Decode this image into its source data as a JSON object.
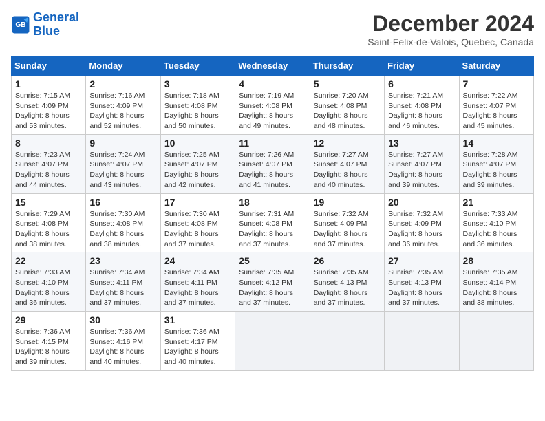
{
  "header": {
    "logo_line1": "General",
    "logo_line2": "Blue",
    "month_year": "December 2024",
    "location": "Saint-Felix-de-Valois, Quebec, Canada"
  },
  "weekdays": [
    "Sunday",
    "Monday",
    "Tuesday",
    "Wednesday",
    "Thursday",
    "Friday",
    "Saturday"
  ],
  "weeks": [
    [
      {
        "day": "1",
        "sunrise": "7:15 AM",
        "sunset": "4:09 PM",
        "daylight": "8 hours and 53 minutes."
      },
      {
        "day": "2",
        "sunrise": "7:16 AM",
        "sunset": "4:09 PM",
        "daylight": "8 hours and 52 minutes."
      },
      {
        "day": "3",
        "sunrise": "7:18 AM",
        "sunset": "4:08 PM",
        "daylight": "8 hours and 50 minutes."
      },
      {
        "day": "4",
        "sunrise": "7:19 AM",
        "sunset": "4:08 PM",
        "daylight": "8 hours and 49 minutes."
      },
      {
        "day": "5",
        "sunrise": "7:20 AM",
        "sunset": "4:08 PM",
        "daylight": "8 hours and 48 minutes."
      },
      {
        "day": "6",
        "sunrise": "7:21 AM",
        "sunset": "4:08 PM",
        "daylight": "8 hours and 46 minutes."
      },
      {
        "day": "7",
        "sunrise": "7:22 AM",
        "sunset": "4:07 PM",
        "daylight": "8 hours and 45 minutes."
      }
    ],
    [
      {
        "day": "8",
        "sunrise": "7:23 AM",
        "sunset": "4:07 PM",
        "daylight": "8 hours and 44 minutes."
      },
      {
        "day": "9",
        "sunrise": "7:24 AM",
        "sunset": "4:07 PM",
        "daylight": "8 hours and 43 minutes."
      },
      {
        "day": "10",
        "sunrise": "7:25 AM",
        "sunset": "4:07 PM",
        "daylight": "8 hours and 42 minutes."
      },
      {
        "day": "11",
        "sunrise": "7:26 AM",
        "sunset": "4:07 PM",
        "daylight": "8 hours and 41 minutes."
      },
      {
        "day": "12",
        "sunrise": "7:27 AM",
        "sunset": "4:07 PM",
        "daylight": "8 hours and 40 minutes."
      },
      {
        "day": "13",
        "sunrise": "7:27 AM",
        "sunset": "4:07 PM",
        "daylight": "8 hours and 39 minutes."
      },
      {
        "day": "14",
        "sunrise": "7:28 AM",
        "sunset": "4:07 PM",
        "daylight": "8 hours and 39 minutes."
      }
    ],
    [
      {
        "day": "15",
        "sunrise": "7:29 AM",
        "sunset": "4:08 PM",
        "daylight": "8 hours and 38 minutes."
      },
      {
        "day": "16",
        "sunrise": "7:30 AM",
        "sunset": "4:08 PM",
        "daylight": "8 hours and 38 minutes."
      },
      {
        "day": "17",
        "sunrise": "7:30 AM",
        "sunset": "4:08 PM",
        "daylight": "8 hours and 37 minutes."
      },
      {
        "day": "18",
        "sunrise": "7:31 AM",
        "sunset": "4:08 PM",
        "daylight": "8 hours and 37 minutes."
      },
      {
        "day": "19",
        "sunrise": "7:32 AM",
        "sunset": "4:09 PM",
        "daylight": "8 hours and 37 minutes."
      },
      {
        "day": "20",
        "sunrise": "7:32 AM",
        "sunset": "4:09 PM",
        "daylight": "8 hours and 36 minutes."
      },
      {
        "day": "21",
        "sunrise": "7:33 AM",
        "sunset": "4:10 PM",
        "daylight": "8 hours and 36 minutes."
      }
    ],
    [
      {
        "day": "22",
        "sunrise": "7:33 AM",
        "sunset": "4:10 PM",
        "daylight": "8 hours and 36 minutes."
      },
      {
        "day": "23",
        "sunrise": "7:34 AM",
        "sunset": "4:11 PM",
        "daylight": "8 hours and 37 minutes."
      },
      {
        "day": "24",
        "sunrise": "7:34 AM",
        "sunset": "4:11 PM",
        "daylight": "8 hours and 37 minutes."
      },
      {
        "day": "25",
        "sunrise": "7:35 AM",
        "sunset": "4:12 PM",
        "daylight": "8 hours and 37 minutes."
      },
      {
        "day": "26",
        "sunrise": "7:35 AM",
        "sunset": "4:13 PM",
        "daylight": "8 hours and 37 minutes."
      },
      {
        "day": "27",
        "sunrise": "7:35 AM",
        "sunset": "4:13 PM",
        "daylight": "8 hours and 37 minutes."
      },
      {
        "day": "28",
        "sunrise": "7:35 AM",
        "sunset": "4:14 PM",
        "daylight": "8 hours and 38 minutes."
      }
    ],
    [
      {
        "day": "29",
        "sunrise": "7:36 AM",
        "sunset": "4:15 PM",
        "daylight": "8 hours and 39 minutes."
      },
      {
        "day": "30",
        "sunrise": "7:36 AM",
        "sunset": "4:16 PM",
        "daylight": "8 hours and 40 minutes."
      },
      {
        "day": "31",
        "sunrise": "7:36 AM",
        "sunset": "4:17 PM",
        "daylight": "8 hours and 40 minutes."
      },
      null,
      null,
      null,
      null
    ]
  ],
  "labels": {
    "sunrise": "Sunrise:",
    "sunset": "Sunset:",
    "daylight": "Daylight:"
  }
}
